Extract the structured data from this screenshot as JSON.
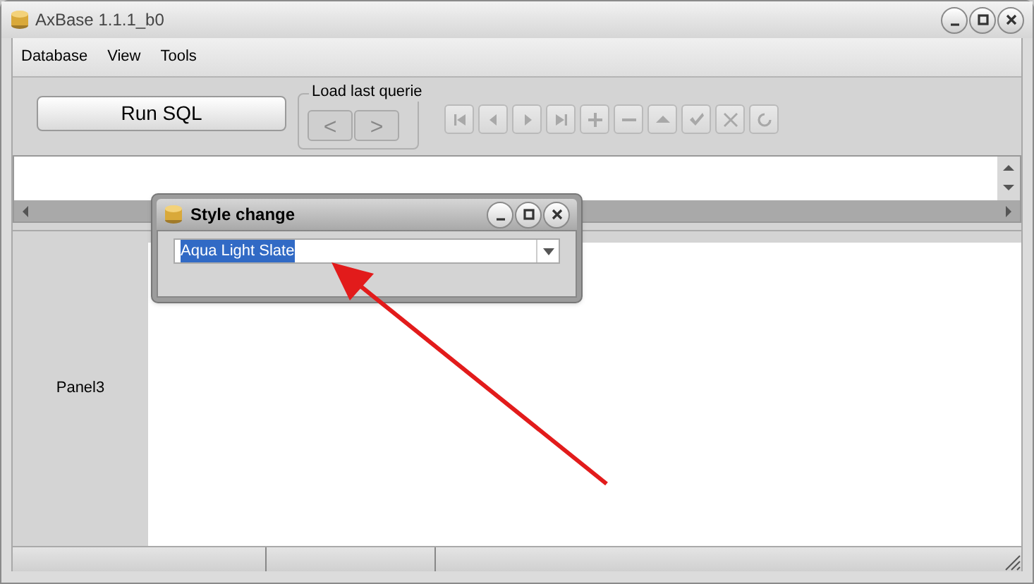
{
  "window": {
    "title": "AxBase 1.1.1_b0"
  },
  "menu": [
    "Database",
    "View",
    "Tools"
  ],
  "toolbar": {
    "run_button": "Run SQL",
    "history": {
      "label": "Load last querie",
      "prev": "<",
      "next": ">"
    },
    "navigator": {
      "disabled": true
    }
  },
  "panel": {
    "label": "Panel3"
  },
  "dialog": {
    "title": "Style change",
    "style": {
      "value": "Aqua Light Slate",
      "value_selected": true
    }
  }
}
